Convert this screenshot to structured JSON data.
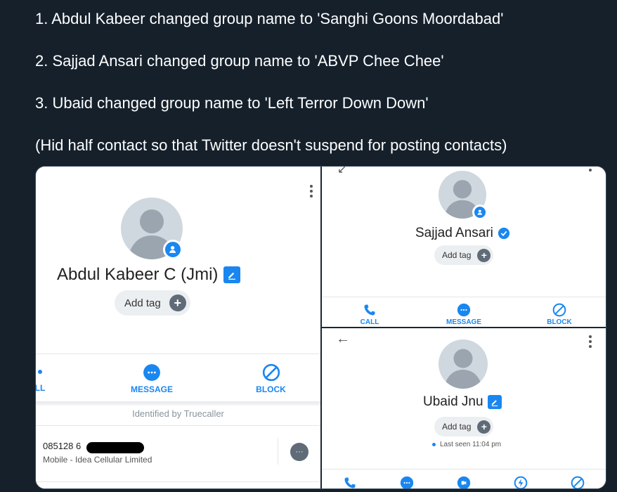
{
  "tweet": {
    "line1": "1. Abdul Kabeer changed group name to 'Sanghi Goons Moordabad'",
    "line2": "2. Sajjad Ansari changed group name to 'ABVP Chee Chee'",
    "line3": "3. Ubaid changed group name to 'Left Terror Down Down'",
    "line4": "(Hid half contact so that Twitter doesn't suspend for posting contacts)"
  },
  "left_panel": {
    "name": "Abdul Kabeer C (Jmi)",
    "add_tag": "Add tag",
    "actions": {
      "call": "LL",
      "message": "MESSAGE",
      "block": "BLOCK"
    },
    "identified": "Identified by Truecaller",
    "number_partial": "085128 6",
    "carrier": "Mobile - Idea Cellular Limited"
  },
  "top_right_panel": {
    "name": "Sajjad Ansari",
    "add_tag": "Add tag",
    "actions": {
      "call": "CALL",
      "message": "MESSAGE",
      "block": "BLOCK"
    }
  },
  "bottom_right_panel": {
    "name": "Ubaid Jnu",
    "add_tag": "Add tag",
    "last_seen": "Last seen 11:04 pm"
  },
  "colors": {
    "accent": "#1a87f0",
    "background": "#15202b"
  }
}
